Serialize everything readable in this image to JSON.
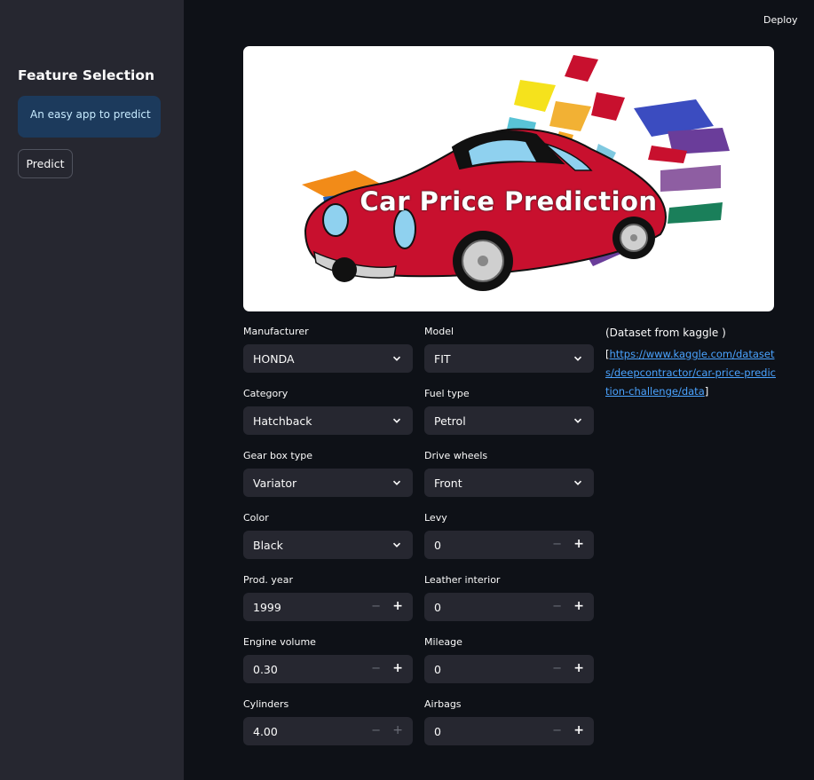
{
  "sidebar": {
    "title": "Feature Selection",
    "info_text": "An easy app to predict",
    "predict_label": "Predict"
  },
  "header": {
    "deploy_label": "Deploy"
  },
  "hero": {
    "title": "Car Price Prediction"
  },
  "form": {
    "manufacturer": {
      "label": "Manufacturer",
      "value": "HONDA"
    },
    "model": {
      "label": "Model",
      "value": "FIT"
    },
    "category": {
      "label": "Category",
      "value": "Hatchback"
    },
    "fuel_type": {
      "label": "Fuel type",
      "value": "Petrol"
    },
    "gear_box_type": {
      "label": "Gear box type",
      "value": "Variator"
    },
    "drive_wheels": {
      "label": "Drive wheels",
      "value": "Front"
    },
    "color": {
      "label": "Color",
      "value": "Black"
    },
    "levy": {
      "label": "Levy",
      "value": "0"
    },
    "prod_year": {
      "label": "Prod. year",
      "value": "1999"
    },
    "leather_interior": {
      "label": "Leather interior",
      "value": "0"
    },
    "engine_volume": {
      "label": "Engine volume",
      "value": "0.30"
    },
    "mileage": {
      "label": "Mileage",
      "value": "0"
    },
    "cylinders": {
      "label": "Cylinders",
      "value": "4.00"
    },
    "airbags": {
      "label": "Airbags",
      "value": "0"
    }
  },
  "stepper": {
    "minus": "−",
    "plus": "+"
  },
  "icons": {
    "dropdown": "chevron-down-icon"
  },
  "dataset": {
    "title": "(Dataset from kaggle )",
    "open_bracket": "[",
    "url": "https://www.kaggle.com/datasets/deepcontractor/car-price-prediction-challenge/data",
    "close_bracket": "]"
  },
  "colors": {
    "background": "#0e1117",
    "sidebar": "#262730",
    "input": "#262730",
    "info": "#1c3a5c",
    "link": "#4aa3ff",
    "car_red": "#c8102e"
  }
}
